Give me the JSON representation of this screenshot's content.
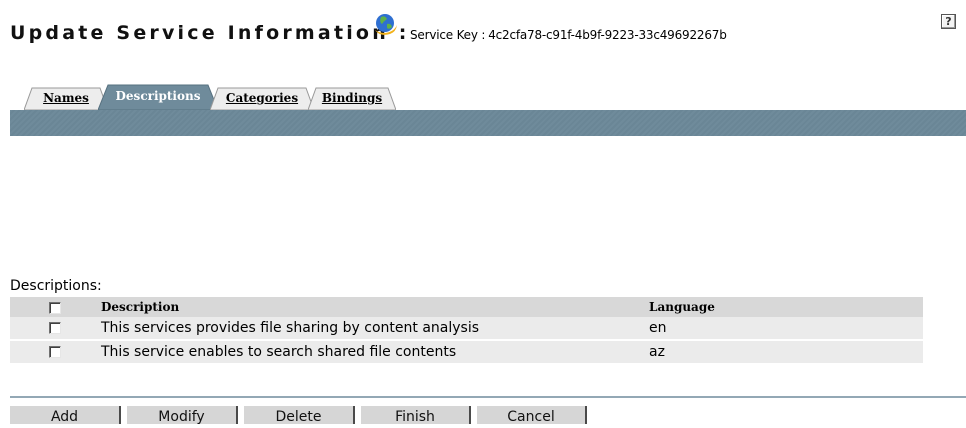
{
  "header": {
    "title": "Update Service Information :",
    "service_key_label": "Service Key :",
    "service_key_value": "4c2cfa78-c91f-4b9f-9223-33c49692267b",
    "help_label": "?"
  },
  "tabs": [
    {
      "label": "Names",
      "active": false
    },
    {
      "label": "Descriptions",
      "active": true
    },
    {
      "label": "Categories",
      "active": false
    },
    {
      "label": "Bindings",
      "active": false
    }
  ],
  "descriptions": {
    "section_label": "Descriptions:",
    "columns": {
      "description": "Description",
      "language": "Language"
    },
    "rows": [
      {
        "description": "This services provides file sharing by content analysis",
        "language": "en",
        "checked": false
      },
      {
        "description": "This service enables to search shared file contents",
        "language": "az",
        "checked": false
      }
    ]
  },
  "buttons": {
    "add": "Add",
    "modify": "Modify",
    "delete": "Delete",
    "finish": "Finish",
    "cancel": "Cancel"
  },
  "colors": {
    "tab_bar": "#6f8b9b",
    "active_tab": "#6f8b9b",
    "inactive_tab": "#ededed",
    "header_row": "#d8d8d8",
    "data_row": "#ebebeb",
    "button": "#d6d6d6"
  },
  "icons": [
    "globe-icon",
    "help-icon",
    "checkbox-icon"
  ]
}
